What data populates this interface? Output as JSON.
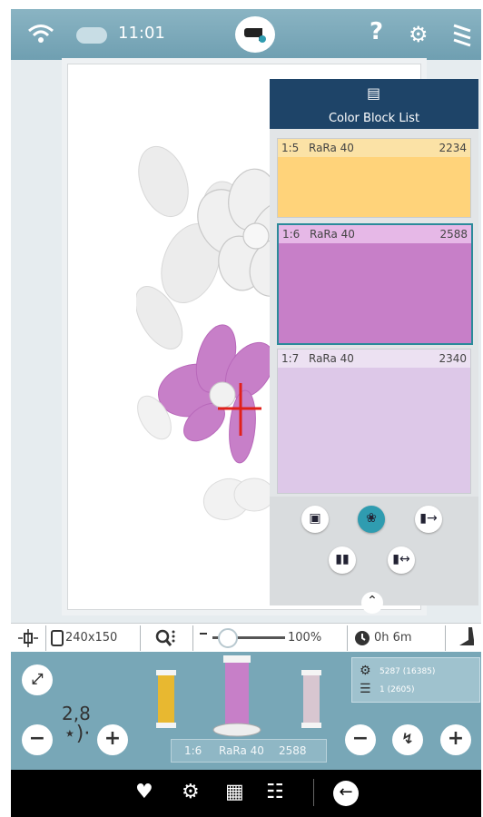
{
  "status_bar": {
    "time": "11:01",
    "icons": [
      "wifi-icon",
      "cloud-icon",
      "machine-icon",
      "help-icon",
      "settings-icon",
      "thread-icon"
    ]
  },
  "color_block_list": {
    "title": "Color Block List",
    "blocks": [
      {
        "number": "1:5",
        "name": "RaRa 40",
        "code": "2234",
        "color": "#ffd37a",
        "selected": false
      },
      {
        "number": "1:6",
        "name": "RaRa 40",
        "code": "2588",
        "color": "#c77fc8",
        "selected": true
      },
      {
        "number": "1:7",
        "name": "RaRa 40",
        "code": "2340",
        "color": "#ddc8e8",
        "selected": false
      }
    ],
    "tool_icons": [
      "select-all-icon",
      "color-group-icon",
      "move-block-last-icon",
      "merge-block-icon",
      "split-block-icon"
    ]
  },
  "info_bar": {
    "hoop_size": "240x150",
    "zoom_percent": "100%",
    "zoom_level_fraction": 0.1,
    "time": "0h 6m"
  },
  "thread_panel": {
    "zoom_value": "2,8",
    "stitches": "5287 (16385)",
    "colors": "1 (2605)",
    "current_color": {
      "number": "1:6",
      "name": "RaRa 40",
      "code": "2588"
    },
    "spools": [
      {
        "color": "#e8b830"
      },
      {
        "color": "#c77fc8"
      },
      {
        "color": "#d8c6d0"
      }
    ]
  },
  "bottom_bar": {
    "icons": [
      "favorite-icon",
      "embroidery-settings-icon",
      "book-icon",
      "manual-icon",
      "back-icon"
    ]
  },
  "colors": {
    "header": "#1e4468",
    "accent": "#2f9cb0",
    "cursor": "#e0201a",
    "orchid": "#c77fc8"
  }
}
